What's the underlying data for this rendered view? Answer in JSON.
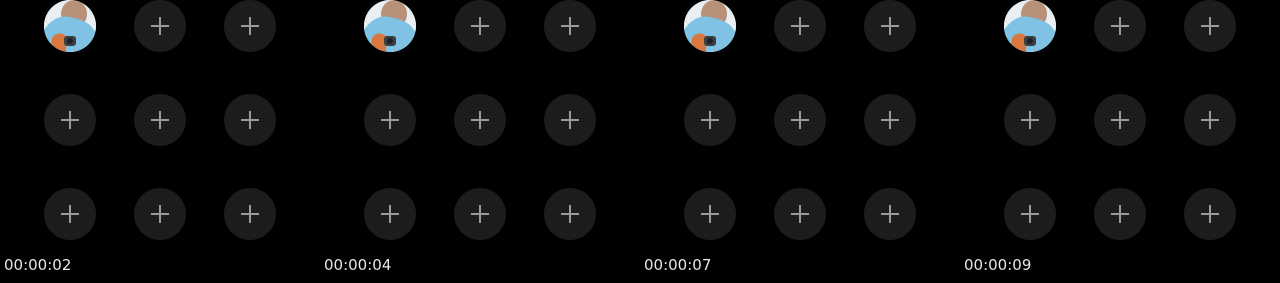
{
  "frames": [
    {
      "timestamp": "00:00:02"
    },
    {
      "timestamp": "00:00:04"
    },
    {
      "timestamp": "00:00:07"
    },
    {
      "timestamp": "00:00:09"
    }
  ],
  "grid": {
    "avatar_slot": "user-avatar-photo",
    "empty_slot_icon": "plus-icon"
  },
  "colors": {
    "background": "#000000",
    "slot_fill": "#1c1c1c",
    "plus_icon": "#9a9a9a",
    "timestamp_text": "#e6e6e6"
  }
}
